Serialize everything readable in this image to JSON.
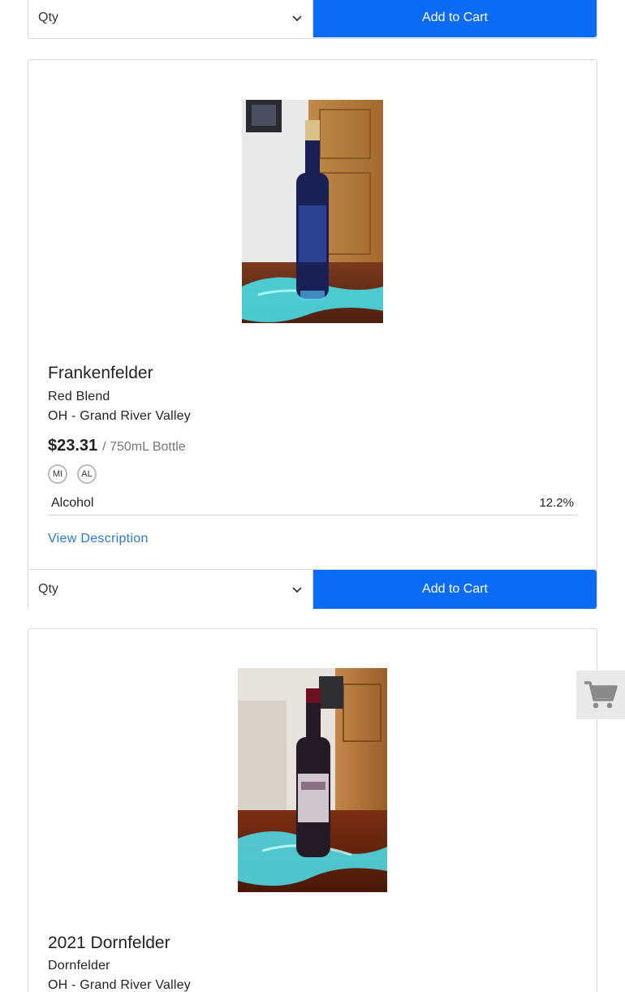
{
  "top_card": {
    "qty_label": "Qty",
    "add_to_cart_label": "Add to Cart"
  },
  "products": [
    {
      "name": "Frankenfelder",
      "varietal": "Red Blend",
      "region": "OH - Grand River Valley",
      "price": "$23.31",
      "unit": "/ 750mL Bottle",
      "badges": [
        "MI",
        "AL"
      ],
      "spec_label": "Alcohol",
      "spec_value": "12.2%",
      "view_description_label": "View Description",
      "qty_label": "Qty",
      "add_to_cart_label": "Add to Cart"
    },
    {
      "name": "2021 Dornfelder",
      "varietal": "Dornfelder",
      "region": "OH - Grand River Valley"
    }
  ],
  "icons": {
    "qty_chevron": "chevron-down-icon",
    "floating_cart": "shopping-cart-icon"
  },
  "colors": {
    "accent": "#0a6cf5",
    "link": "#2a7acb",
    "border": "#d8d8d8"
  }
}
